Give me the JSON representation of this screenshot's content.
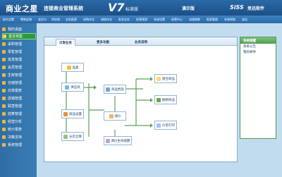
{
  "header": {
    "title": "商业之星",
    "subtitle": "连锁商业管理系统",
    "version": "V7",
    "edition": "标准版",
    "demo": "演示版",
    "brand_logo": "SiSS",
    "brand_name": "思迅软件"
  },
  "menu": [
    "前台设置",
    "零售促销",
    "会员卡",
    "供应商",
    "业务报表",
    "采购作业",
    "调拨作业",
    "批发业务",
    "经营预测",
    "系统设置",
    "经营中心",
    "流通销售",
    "报表管理",
    "系统帮助",
    "退出"
  ],
  "sidebar": {
    "items": [
      {
        "label": "我的桌面"
      },
      {
        "label": "基本档案",
        "active": true
      },
      {
        "label": "采购管理"
      },
      {
        "label": "零售管理"
      },
      {
        "label": "批发管理"
      },
      {
        "label": "会员管理"
      },
      {
        "label": "生鲜管理"
      },
      {
        "label": "仓储管理"
      },
      {
        "label": "日常报表"
      },
      {
        "label": "促销管理"
      },
      {
        "label": "联营管理"
      },
      {
        "label": "结算管理"
      },
      {
        "label": "经营分析"
      },
      {
        "label": "统计报表"
      },
      {
        "label": "决策支持"
      },
      {
        "label": "系统管理"
      }
    ]
  },
  "tabs": [
    "日常业务",
    "更多功能",
    "业务说明"
  ],
  "flow": {
    "nodes": {
      "category": "品类",
      "supplier": "供应商",
      "product_settings": "商品设置",
      "branch_warehouse": "分店仓库",
      "product_archive": "商品档案",
      "price_adjust": "调价",
      "price_info": "调价生效提醒",
      "combo_product": "组合商品",
      "bulk_product": "捆绑商品",
      "label_print": "价签打印"
    }
  },
  "right_panel": {
    "title": "系统提醒",
    "items": [
      "系统公告",
      "我的邮件"
    ]
  },
  "colors": {
    "header": "#1b4f86",
    "sidebar": "#3b7db5",
    "content_bg": "#c2dcef",
    "active_item": "#2b9a3a",
    "accent_green": "#4f9c4f"
  }
}
